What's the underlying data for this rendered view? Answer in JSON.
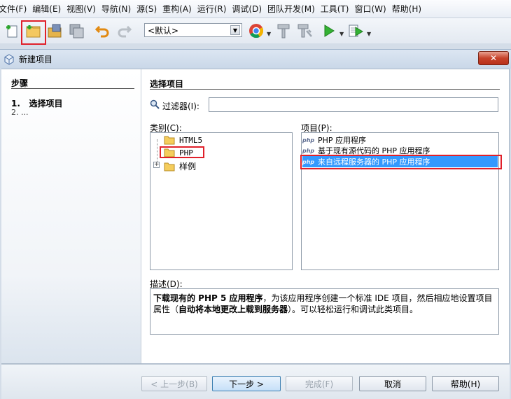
{
  "menubar": {
    "items": [
      "文件(F)",
      "编辑(E)",
      "视图(V)",
      "导航(N)",
      "源(S)",
      "重构(A)",
      "运行(R)",
      "调试(D)",
      "团队开发(M)",
      "工具(T)",
      "窗口(W)",
      "帮助(H)"
    ]
  },
  "toolbar": {
    "config_value": "<默认>"
  },
  "dialog": {
    "title": "新建项目",
    "steps_title": "步骤",
    "step1_num": "1.",
    "step1_label": "选择项目",
    "step2": "2.    ...",
    "main_title": "选择项目",
    "filter_label": "过滤器(I):",
    "filter_value": "",
    "categories_label": "类别(C):",
    "projects_label": "项目(P):",
    "categories": [
      "HTML5",
      "PHP",
      "样例"
    ],
    "php_badge": "php",
    "projects": [
      "PHP 应用程序",
      "基于现有源代码的 PHP 应用程序",
      "来自远程服务器的 PHP 应用程序"
    ],
    "description_label": "描述(D):",
    "description_bold": "下载现有的 PHP 5 应用程序",
    "description_mid": "，为该应用程序创建一个标准 IDE 项目，然后相应地设置项目属性（",
    "description_bold2": "自动将本地更改上载到服务器",
    "description_end": "）。可以轻松运行和调试此类项目。",
    "buttons": {
      "back": "< 上一步(B)",
      "next": "下一步 >",
      "finish": "完成(F)",
      "cancel": "取消",
      "help": "帮助(H)"
    }
  },
  "colors": {
    "highlight_red": "#e0202a",
    "selection_blue": "#3399ff"
  }
}
